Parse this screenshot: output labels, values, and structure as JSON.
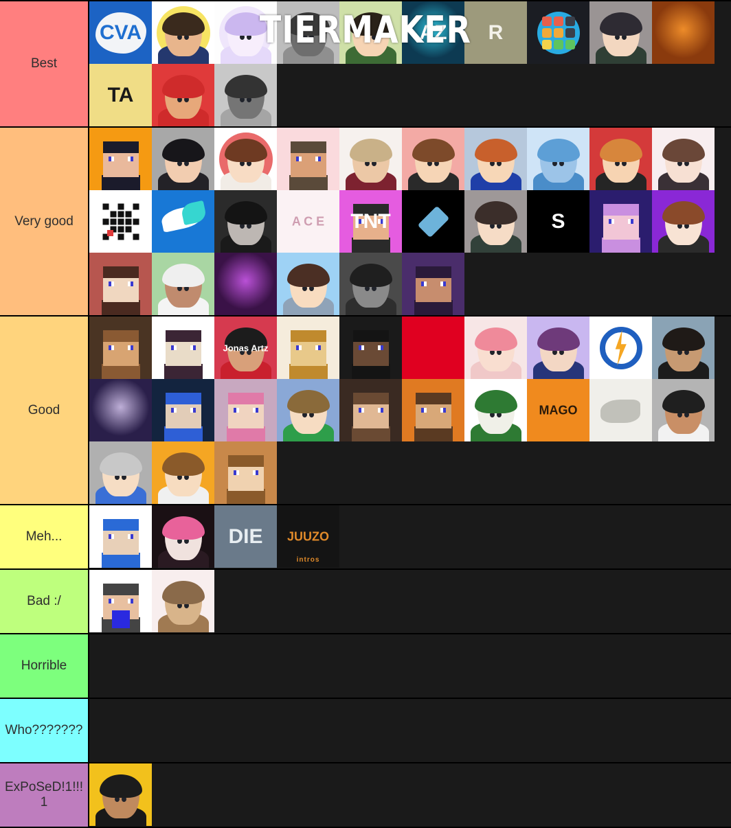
{
  "watermark": {
    "text": "TIERMAKER"
  },
  "tiers": [
    {
      "label": "Best",
      "color": "#ff7f7f",
      "items": [
        {
          "name": "cva-splatter-logo",
          "kind": "logo-splat",
          "text": "CVA",
          "bg": "#1c63c4",
          "fg": "#1f6fd0"
        },
        {
          "name": "hoodie-peace-avatar",
          "kind": "person",
          "bg": "#ffffff",
          "accent": "#f7e463",
          "skin": "#e8b58c",
          "hairc": "#3a2a1d",
          "shirt": "#24386e"
        },
        {
          "name": "white-purple-anime-avatar",
          "kind": "person",
          "bg": "#fdfdfd",
          "accent": "#efe6fb",
          "skin": "#f7eefc",
          "hairc": "#cbb7ef",
          "shirt": "#e5d9fa"
        },
        {
          "name": "grayscale-boy-photo",
          "kind": "photo-bw",
          "bg": "#bdbdbd",
          "skin": "#6e6e6e",
          "hairc": "#3a3a3a",
          "shirt": "#8f8f8f"
        },
        {
          "name": "waving-green-anime-avatar",
          "kind": "person",
          "bg": "#cfe0a8",
          "skin": "#f6d4b4",
          "hairc": "#2a2219",
          "shirt": "#3d6b35"
        },
        {
          "name": "blue-glow-gamer-photo",
          "kind": "photo-glow",
          "bg": "#0d3a52",
          "accent": "#33d6f0",
          "text": "AZ"
        },
        {
          "name": "stone-rock-r-logo",
          "kind": "logo-letter",
          "text": "R",
          "bg": "#9d9a7c",
          "fg": "#f3f1ea"
        },
        {
          "name": "explore-grid-icon",
          "kind": "logo-grid",
          "bg": "#1b1d23",
          "accent": "#29abe2"
        },
        {
          "name": "chibi-cap-character",
          "kind": "person",
          "bg": "#9a9494",
          "skin": "#f3d7c0",
          "hairc": "#2e2b33",
          "shirt": "#2f3f35"
        },
        {
          "name": "orange-explosion-banner",
          "kind": "photo-glow",
          "bg": "#8a3a0d",
          "accent": "#ff9a2e",
          "text": ""
        },
        {
          "name": "gold-ta-logo",
          "kind": "logo-letter",
          "text": "TA",
          "bg": "#f0dd86",
          "fg": "#191919"
        },
        {
          "name": "red-fox-hoodie-avatar",
          "kind": "person",
          "bg": "#e03a3a",
          "skin": "#e7a87a",
          "hairc": "#cf2b2b",
          "shirt": "#cf2b2b"
        },
        {
          "name": "grayscale-boy-photo-2",
          "kind": "photo-bw",
          "bg": "#c8c8c8",
          "skin": "#757575",
          "hairc": "#333333",
          "shirt": "#a5a5a5"
        }
      ]
    },
    {
      "label": "Very good",
      "color": "#ffbe7d",
      "items": [
        {
          "name": "orange-splatter-mc-skin",
          "kind": "mc",
          "bg": "#f59a12",
          "hairc": "#1b1b2b",
          "skin": "#e9b99c"
        },
        {
          "name": "white-hood-smirk-avatar",
          "kind": "person",
          "bg": "#a8a8a8",
          "skin": "#f2cdb0",
          "hairc": "#17161a",
          "shirt": "#232227"
        },
        {
          "name": "red-bg-chibi-avatar",
          "kind": "person",
          "bg": "#ffffff",
          "accent": "#e96a6a",
          "skin": "#f8dcc4",
          "hairc": "#6e3a22",
          "shirt": "#f1ece6"
        },
        {
          "name": "crown-mc-avatar",
          "kind": "mc",
          "bg": "#fadadd",
          "hairc": "#5a4a3a",
          "skin": "#dba077"
        },
        {
          "name": "blond-anime-red-jacket",
          "kind": "person",
          "bg": "#f6f1ee",
          "skin": "#ecc8a6",
          "hairc": "#c9b188",
          "shirt": "#7d2230"
        },
        {
          "name": "pink-bg-glasses-boy",
          "kind": "person",
          "bg": "#f3aaa5",
          "skin": "#f6d5b6",
          "hairc": "#7d4a2a",
          "shirt": "#2a2a2a"
        },
        {
          "name": "blue-hoodie-ok-avatar",
          "kind": "person",
          "bg": "#b6c8dc",
          "skin": "#f7d7b7",
          "hairc": "#c8602c",
          "shirt": "#1f3fa8"
        },
        {
          "name": "blue-snow-robot-avatar",
          "kind": "person",
          "bg": "#cfe4f7",
          "skin": "#9cc4e8",
          "hairc": "#5d9fd6",
          "shirt": "#4a8dc9"
        },
        {
          "name": "red-cap-anime-avatar",
          "kind": "person",
          "bg": "#d43a3a",
          "skin": "#f7d4b2",
          "hairc": "#d7863c",
          "shirt": "#252525"
        },
        {
          "name": "brown-hair-shy-avatar",
          "kind": "person",
          "bg": "#f8eef0",
          "skin": "#f7e0d3",
          "hairc": "#6a4738",
          "shirt": "#3a3036"
        },
        {
          "name": "pixel-checker-icon",
          "kind": "logo-pixel",
          "bg": "#ffffff",
          "fg": "#111111",
          "accent": "#e03a3a"
        },
        {
          "name": "blue-teal-swoosh-logo",
          "kind": "logo-swoosh",
          "bg": "#1878d6",
          "accent": "#36d6d0",
          "fg": "#ffffff"
        },
        {
          "name": "bw-selfie-photo",
          "kind": "photo-bw",
          "bg": "#2b2b2b",
          "skin": "#bdb7b3",
          "hairc": "#141414",
          "shirt": "#1a1a1a"
        },
        {
          "name": "pink-ace-logo",
          "kind": "logo-letter",
          "text": "A C E",
          "bg": "#fbf2f4",
          "fg": "#cf9eb1"
        },
        {
          "name": "tnt-mc-avatar",
          "kind": "mc",
          "bg": "#e55ce0",
          "hairc": "#2a2a2a",
          "skin": "#e7b08b",
          "text": "TNT"
        },
        {
          "name": "blue-diamond-icon",
          "kind": "logo-gem",
          "bg": "#000000",
          "accent": "#79c7f2"
        },
        {
          "name": "chibi-white-cap-avatar",
          "kind": "person",
          "bg": "#9e9898",
          "skin": "#f6dcc6",
          "hairc": "#3b2e2a",
          "shirt": "#32413a"
        },
        {
          "name": "white-s-logo",
          "kind": "logo-letter",
          "text": "S",
          "bg": "#000000",
          "fg": "#ffffff"
        },
        {
          "name": "purple-mc-render",
          "kind": "mc",
          "bg": "#2b1d6e",
          "hairc": "#c98fe0",
          "skin": "#f2c6d6"
        },
        {
          "name": "hush-anime-hoodie",
          "kind": "person",
          "bg": "#8a28d6",
          "skin": "#f8e3d4",
          "hairc": "#8a4a2a",
          "shirt": "#2b2b2b"
        },
        {
          "name": "pixel-art-mc-closeup",
          "kind": "mc",
          "bg": "#b7564f",
          "hairc": "#4a2a20",
          "skin": "#f0d7c0"
        },
        {
          "name": "white-hair-green-bg-avatar",
          "kind": "person",
          "bg": "#a9d6a3",
          "skin": "#c08b6e",
          "hairc": "#efefef",
          "shirt": "#f4f4f4"
        },
        {
          "name": "purple-neon-photo",
          "kind": "photo-glow",
          "bg": "#3a1247",
          "accent": "#d05cf0",
          "text": ""
        },
        {
          "name": "blue-cap-chibi-avatar",
          "kind": "person",
          "bg": "#9ed2f5",
          "skin": "#f8dcc0",
          "hairc": "#4b2f24",
          "shirt": "#8fa3b8"
        },
        {
          "name": "bw-tongue-photo",
          "kind": "photo-bw",
          "bg": "#4a4a4a",
          "skin": "#8a8a8a",
          "hairc": "#1f1f1f",
          "shirt": "#2e2e2e"
        },
        {
          "name": "dark-mc-render",
          "kind": "mc",
          "bg": "#4a2d6b",
          "hairc": "#2a1a3a",
          "skin": "#c78d6e"
        }
      ]
    },
    {
      "label": "Good",
      "color": "#ffd47d",
      "items": [
        {
          "name": "brown-mc-duo-render",
          "kind": "mc",
          "bg": "#4a3423",
          "hairc": "#8a5a33",
          "skin": "#d8a472"
        },
        {
          "name": "white-bg-mc-head",
          "kind": "mc",
          "bg": "#ffffff",
          "hairc": "#3b2535",
          "skin": "#e9dcc8"
        },
        {
          "name": "jonas-artz-avatar",
          "kind": "person",
          "bg": "#d63a4f",
          "skin": "#d8a07a",
          "hairc": "#1c1c1c",
          "shirt": "#c9202d",
          "text": "Jonas Artz"
        },
        {
          "name": "golden-mc-render",
          "kind": "mc",
          "bg": "#f5ecdc",
          "hairc": "#c08a2e",
          "skin": "#e8c98a"
        },
        {
          "name": "dark-mc-avatar",
          "kind": "mc",
          "bg": "#1a1a1a",
          "hairc": "#141414",
          "skin": "#6a4a35"
        },
        {
          "name": "red-sneakers-logo",
          "kind": "logo-letter",
          "text": "",
          "bg": "#e00020",
          "fg": "#ffffff"
        },
        {
          "name": "pink-hair-anime-avatar",
          "kind": "person",
          "bg": "#f7e6e6",
          "skin": "#f9ded0",
          "hairc": "#ef8a9a",
          "shirt": "#f0c8c8"
        },
        {
          "name": "purple-bg-glasses-anime",
          "kind": "person",
          "bg": "#c9b7f0",
          "skin": "#f3d7c4",
          "hairc": "#6e3a7a",
          "shirt": "#27357a"
        },
        {
          "name": "blue-lightning-logo",
          "kind": "logo-bolt",
          "bg": "#ffffff",
          "accent": "#1f5fbf",
          "fg": "#f5a623"
        },
        {
          "name": "lake-black-shirt-photo",
          "kind": "photo-real",
          "bg": "#8aa3b5",
          "skin": "#c79a72",
          "hairc": "#1f1a17",
          "shirt": "#1c1c1c"
        },
        {
          "name": "moon-night-render",
          "kind": "photo-glow",
          "bg": "#2a1f4a",
          "accent": "#d8c8f0",
          "text": ""
        },
        {
          "name": "blue-neon-mc-render",
          "kind": "mc",
          "bg": "#13243f",
          "hairc": "#2e5fd6",
          "skin": "#e2cdb8"
        },
        {
          "name": "pixel-pink-mc-avatar",
          "kind": "mc",
          "bg": "#c8a8c0",
          "hairc": "#e07aa8",
          "skin": "#f0d4c0"
        },
        {
          "name": "green-hoodie-anime-boy",
          "kind": "person",
          "bg": "#8aa8d6",
          "skin": "#f6dcc2",
          "hairc": "#8a6a3a",
          "shirt": "#2e9e4a"
        },
        {
          "name": "mc-fist-render",
          "kind": "mc",
          "bg": "#3a2a22",
          "hairc": "#6a4a33",
          "skin": "#e0b894"
        },
        {
          "name": "bearded-mc-render",
          "kind": "mc",
          "bg": "#e07a22",
          "hairc": "#5a3a22",
          "skin": "#d8a878"
        },
        {
          "name": "green-furry-avatar",
          "kind": "person",
          "bg": "#ffffff",
          "skin": "#f0f0e8",
          "hairc": "#2e7a33",
          "shirt": "#2e7a33"
        },
        {
          "name": "mago-orange-logo",
          "kind": "logo-letter",
          "text": "MAGO",
          "bg": "#f08a1e",
          "fg": "#2a1a0a"
        },
        {
          "name": "pencil-sketch-photo",
          "kind": "photo-sketch",
          "bg": "#f0efea",
          "fg": "#9a9a92"
        },
        {
          "name": "black-cap-avatar",
          "kind": "person",
          "bg": "#b4b4b4",
          "skin": "#c98f66",
          "hairc": "#1f1f1f",
          "shirt": "#f2f2f2"
        },
        {
          "name": "blue-hoodie-cartoon",
          "kind": "person",
          "bg": "#b0b0b0",
          "skin": "#f6ddc4",
          "hairc": "#c8c8c8",
          "shirt": "#3a6fd6"
        },
        {
          "name": "orange-cartoon-boy",
          "kind": "person",
          "bg": "#f5a623",
          "skin": "#f7dcc0",
          "hairc": "#8a5a2a",
          "shirt": "#f0f0f0"
        },
        {
          "name": "pixel-orange-mc",
          "kind": "mc",
          "bg": "#c8884a",
          "hairc": "#8a5a2a",
          "skin": "#f0d2b0"
        }
      ]
    },
    {
      "label": "Meh...",
      "color": "#ffff7d",
      "items": [
        {
          "name": "mc-blue-render-youtube",
          "kind": "mc",
          "bg": "#ffffff",
          "hairc": "#2a6ad6",
          "skin": "#e8d0b8"
        },
        {
          "name": "pink-hair-anime-photo",
          "kind": "person",
          "bg": "#1a1014",
          "skin": "#f0e2de",
          "hairc": "#e8629a",
          "shirt": "#2a1a22"
        },
        {
          "name": "die-globe-logo",
          "kind": "logo-letter",
          "text": "DIE",
          "bg": "#6a7a8a",
          "fg": "#e8eef2"
        },
        {
          "name": "juuzo-intros-logo",
          "kind": "logo-letter",
          "text": "JUUZO",
          "bg": "#141414",
          "fg": "#e08a2a",
          "sub": "intros"
        }
      ]
    },
    {
      "label": "Bad :/",
      "color": "#beff7d",
      "items": [
        {
          "name": "green-alien-pixel-character",
          "kind": "pixel-char",
          "bg": "#ffffff",
          "fg": "#3ae03a",
          "accent": "#2a2ae0"
        },
        {
          "name": "rigby-raccoon-cartoon",
          "kind": "person",
          "bg": "#f8eeee",
          "skin": "#d8b48a",
          "hairc": "#8a6a4a",
          "shirt": "#a07a52"
        }
      ]
    },
    {
      "label": "Horrible",
      "color": "#7dff7d",
      "items": []
    },
    {
      "label": "Who???????",
      "color": "#7dffff",
      "items": []
    },
    {
      "label": "ExPoSeD!1!!!1",
      "color": "#be7dbe",
      "items": [
        {
          "name": "yellow-bg-man-photo",
          "kind": "photo-real",
          "bg": "#f2c11c",
          "skin": "#c08a5e",
          "hairc": "#1c1c1c",
          "shirt": "#191919"
        }
      ]
    }
  ]
}
